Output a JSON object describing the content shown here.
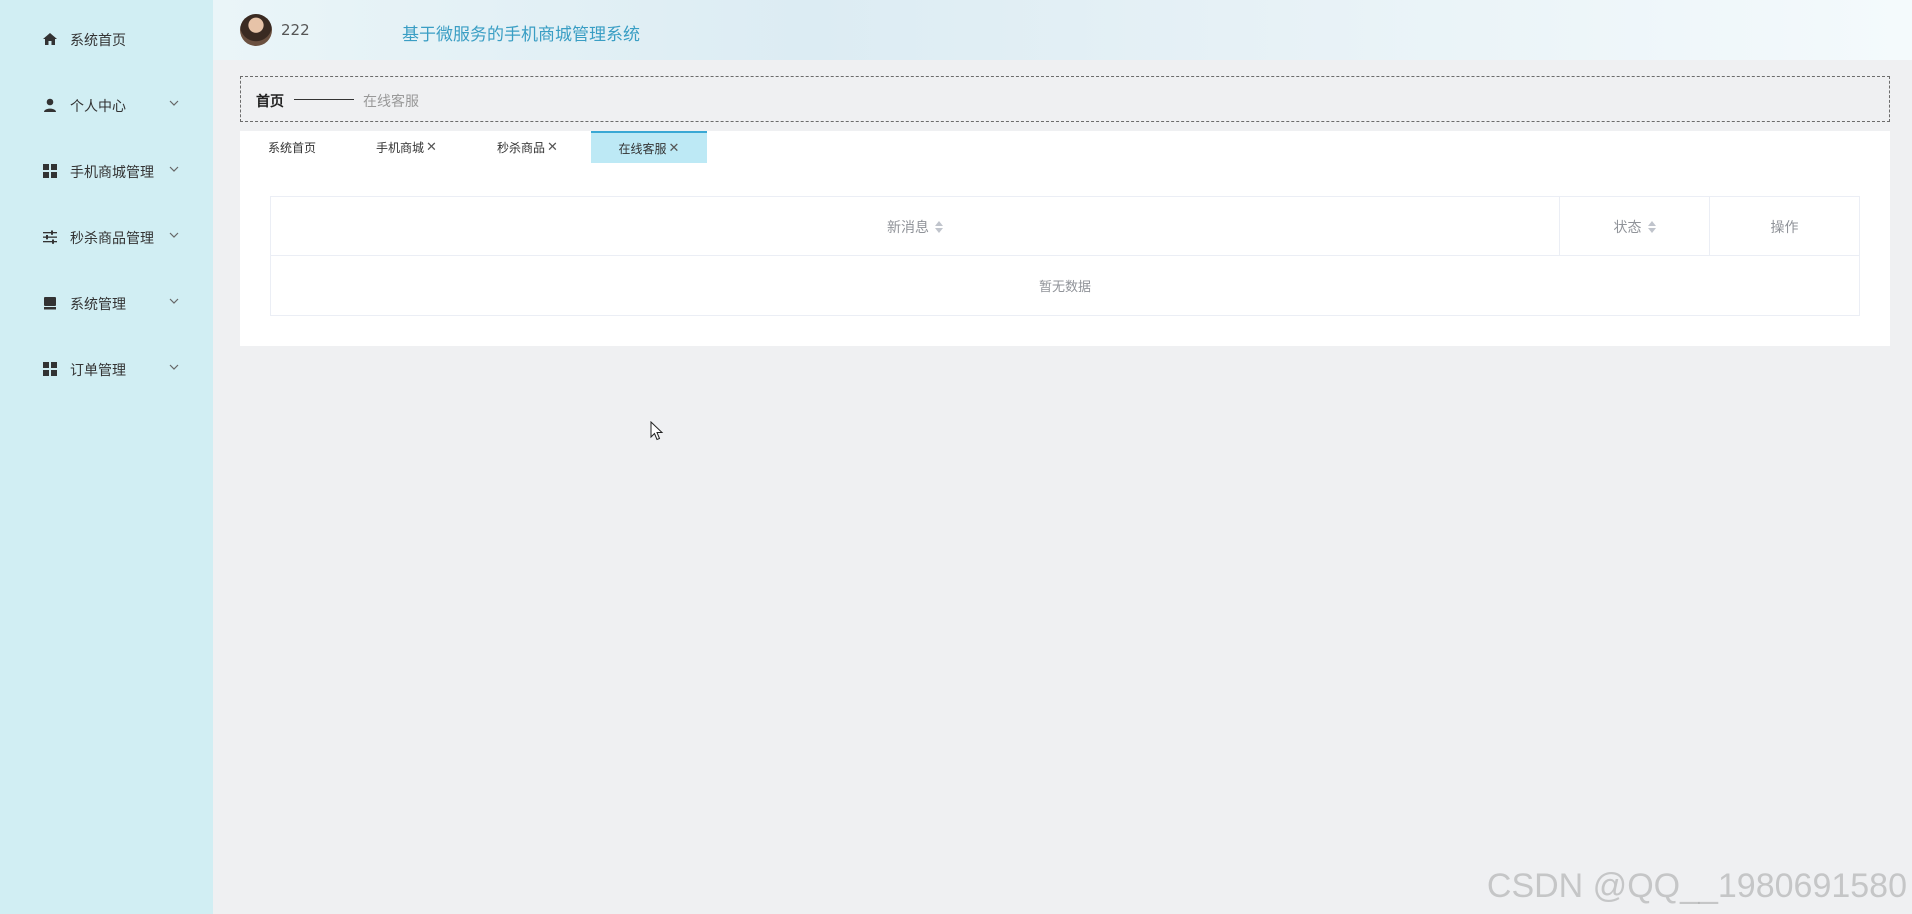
{
  "header": {
    "username": "222",
    "app_title": "基于微服务的手机商城管理系统"
  },
  "sidebar": {
    "items": [
      {
        "label": "系统首页",
        "icon": "home-icon"
      },
      {
        "label": "个人中心",
        "icon": "user-icon"
      },
      {
        "label": "手机商城管理",
        "icon": "grid-icon"
      },
      {
        "label": "秒杀商品管理",
        "icon": "sliders-icon"
      },
      {
        "label": "系统管理",
        "icon": "device-icon"
      },
      {
        "label": "订单管理",
        "icon": "grid-icon"
      }
    ]
  },
  "breadcrumb": {
    "home": "首页",
    "current": "在线客服"
  },
  "tabs": [
    {
      "label": "系统首页",
      "closable": false
    },
    {
      "label": "手机商城",
      "closable": true
    },
    {
      "label": "秒杀商品",
      "closable": true
    },
    {
      "label": "在线客服",
      "closable": true,
      "active": true
    }
  ],
  "table": {
    "columns": [
      "新消息",
      "状态",
      "操作"
    ],
    "empty_text": "暂无数据"
  },
  "watermark": "CSDN @QQ__1980691580",
  "colors": {
    "sidebar_bg": "#d1eef3",
    "title": "#3a9ec4",
    "active_tab": "#bde9f5"
  }
}
